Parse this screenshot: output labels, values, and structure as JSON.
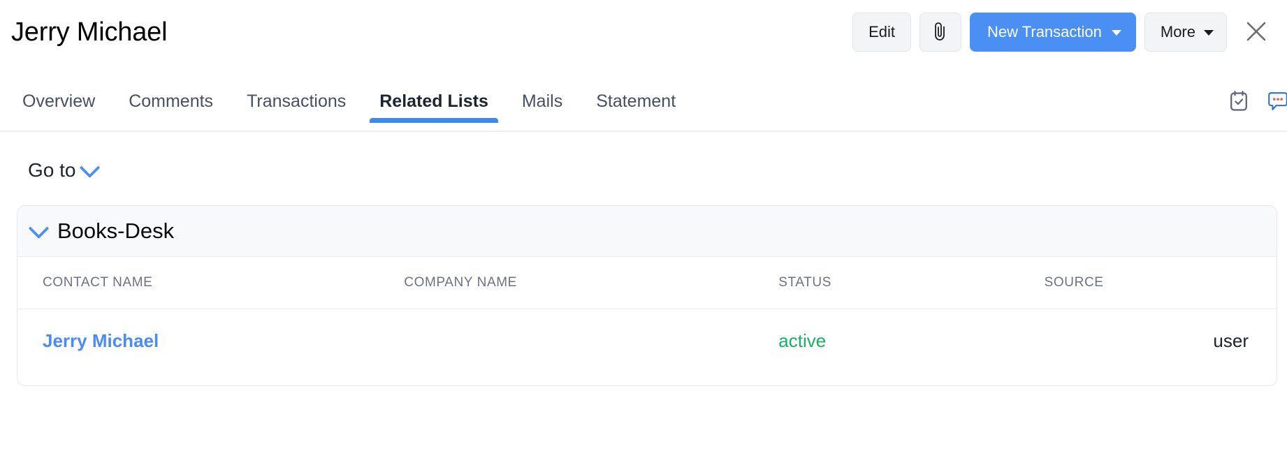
{
  "header": {
    "title": "Jerry Michael",
    "actions": {
      "edit_label": "Edit",
      "attachment_icon": "paperclip-icon",
      "new_transaction_label": "New Transaction",
      "more_label": "More",
      "close_icon": "close-icon"
    },
    "colors": {
      "primary": "#4a90f4",
      "button_bg": "#f3f4f6",
      "close": "#6b6b6b"
    }
  },
  "tabs": {
    "items": [
      {
        "label": "Overview",
        "active": false
      },
      {
        "label": "Comments",
        "active": false
      },
      {
        "label": "Transactions",
        "active": false
      },
      {
        "label": "Related Lists",
        "active": true
      },
      {
        "label": "Mails",
        "active": false
      },
      {
        "label": "Statement",
        "active": false
      }
    ],
    "right_icons": [
      {
        "name": "task-clipboard-icon",
        "color": "#5c6378"
      },
      {
        "name": "chat-bubble-dots-icon",
        "color": "#2f6fd0",
        "dot_color": "#e35b5b"
      }
    ],
    "active_underline_color": "#3c8af0"
  },
  "goto": {
    "label": "Go to",
    "icon": "chevron-down-icon"
  },
  "related_list": {
    "section_title": "Books-Desk",
    "collapse_icon": "chevron-down-icon",
    "columns": [
      "CONTACT NAME",
      "COMPANY NAME",
      "STATUS",
      "SOURCE"
    ],
    "rows": [
      {
        "contact_name": "Jerry Michael",
        "company_name": "",
        "status": "active",
        "source": "user"
      }
    ],
    "colors": {
      "link": "#4a8cf7",
      "status_active": "#16b364",
      "header_bg": "#f8f9fb"
    }
  }
}
